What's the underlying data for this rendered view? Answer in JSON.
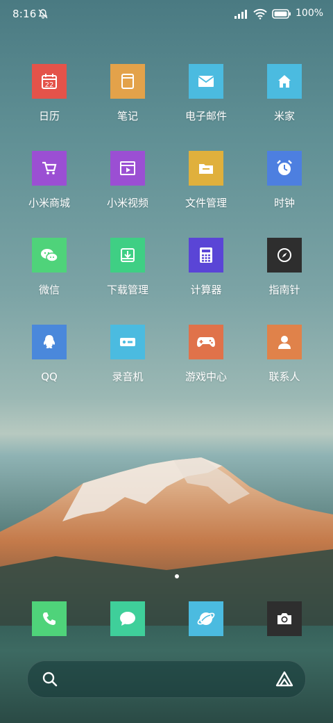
{
  "status_bar": {
    "time": "8:16",
    "battery_percent": "100%"
  },
  "apps": [
    {
      "label": "日历",
      "icon": "calendar-icon",
      "color": "#e4534a",
      "badge": "22"
    },
    {
      "label": "笔记",
      "icon": "notes-icon",
      "color": "#e3a24a"
    },
    {
      "label": "电子邮件",
      "icon": "mail-icon",
      "color": "#4bbbe0"
    },
    {
      "label": "米家",
      "icon": "home-icon",
      "color": "#4bbbe0"
    },
    {
      "label": "小米商城",
      "icon": "cart-icon",
      "color": "#9b4fd3"
    },
    {
      "label": "小米视频",
      "icon": "video-icon",
      "color": "#9b4fd3"
    },
    {
      "label": "文件管理",
      "icon": "folder-icon",
      "color": "#e0b03c"
    },
    {
      "label": "时钟",
      "icon": "clock-icon",
      "color": "#4d7fe0"
    },
    {
      "label": "微信",
      "icon": "wechat-icon",
      "color": "#4fd37a"
    },
    {
      "label": "下载管理",
      "icon": "download-icon",
      "color": "#3fcf84"
    },
    {
      "label": "计算器",
      "icon": "calculator-icon",
      "color": "#5a45d6"
    },
    {
      "label": "指南针",
      "icon": "compass-icon",
      "color": "#2e2e2e"
    },
    {
      "label": "QQ",
      "icon": "qq-icon",
      "color": "#4a88db"
    },
    {
      "label": "录音机",
      "icon": "recorder-icon",
      "color": "#4bbbe0"
    },
    {
      "label": "游戏中心",
      "icon": "gamepad-icon",
      "color": "#e0724a"
    },
    {
      "label": "联系人",
      "icon": "contacts-icon",
      "color": "#e0824a"
    }
  ],
  "dock": [
    {
      "icon": "phone-icon",
      "color": "#4fd37a"
    },
    {
      "icon": "message-icon",
      "color": "#3fcf9a"
    },
    {
      "icon": "browser-icon",
      "color": "#4bbbe0"
    },
    {
      "icon": "camera-icon",
      "color": "#2e2e2e"
    }
  ],
  "page_indicator": {
    "current": 1,
    "total": 1
  }
}
